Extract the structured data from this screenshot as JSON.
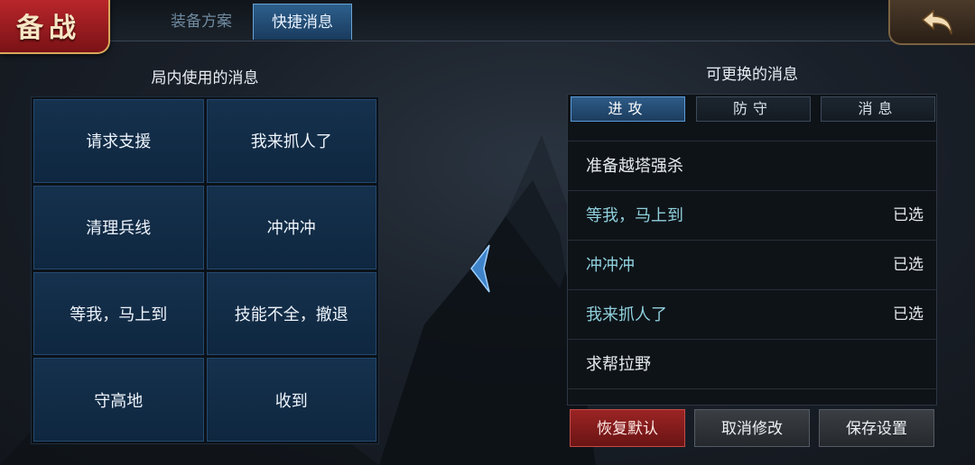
{
  "header": {
    "title": "备战",
    "tabs": [
      {
        "label": "装备方案",
        "active": false
      },
      {
        "label": "快捷消息",
        "active": true
      }
    ]
  },
  "left": {
    "title": "局内使用的消息",
    "cells": [
      "请求支援",
      "我来抓人了",
      "清理兵线",
      "冲冲冲",
      "等我，马上到",
      "技能不全，撤退",
      "守高地",
      "收到"
    ]
  },
  "right": {
    "title": "可更换的消息",
    "tabs": [
      {
        "label": "进攻",
        "active": true
      },
      {
        "label": "防守",
        "active": false
      },
      {
        "label": "消息",
        "active": false
      }
    ],
    "items": [
      {
        "label": "准备越塔强杀",
        "status": ""
      },
      {
        "label": "等我，马上到",
        "status": "已选"
      },
      {
        "label": "冲冲冲",
        "status": "已选"
      },
      {
        "label": "我来抓人了",
        "status": "已选"
      },
      {
        "label": "求帮拉野",
        "status": ""
      }
    ]
  },
  "buttons": {
    "reset": "恢复默认",
    "cancel": "取消修改",
    "save": "保存设置"
  },
  "colors": {
    "accent": "#2e5b87",
    "selected_text": "#8fd0dc",
    "reset_button": "#9b2424"
  }
}
